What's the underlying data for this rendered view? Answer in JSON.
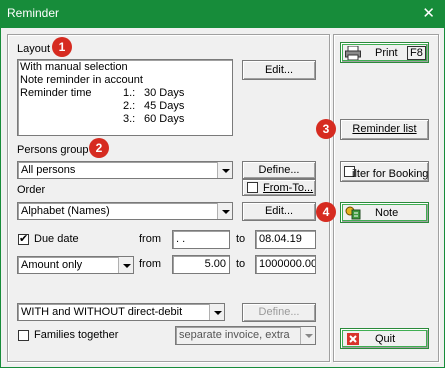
{
  "window": {
    "title": "Reminder",
    "close_symbol": "✕"
  },
  "layout": {
    "label": "Layout",
    "lines": [
      "With manual selection",
      "Note reminder in account"
    ],
    "reminder_time_label": "Reminder time",
    "levels": [
      {
        "n": "1.:",
        "days": "30 Days"
      },
      {
        "n": "2.:",
        "days": "45 Days"
      },
      {
        "n": "3.:",
        "days": "60 Days"
      }
    ],
    "edit_label": "Edit..."
  },
  "persons_group": {
    "label": "Persons group",
    "value": "All persons",
    "define_label": "Define...",
    "from_to_label": "From-To..."
  },
  "order": {
    "label": "Order",
    "value": "Alphabet (Names)",
    "edit_label": "Edit..."
  },
  "due_date": {
    "label": "Due date",
    "checked": true,
    "from_label": "from",
    "from_value": " .  .",
    "to_label": "to",
    "to_value": "08.04.19"
  },
  "amount": {
    "mode_value": "Amount only",
    "from_label": "from",
    "from_value": "5.00",
    "to_label": "to",
    "to_value": "1000000.00"
  },
  "direct_debit": {
    "value": "WITH and WITHOUT direct-debit",
    "define_label": "Define..."
  },
  "families": {
    "label": "Families together",
    "checked": false,
    "invoice_value": "separate invoice, extra"
  },
  "side": {
    "print_label": "Print",
    "print_key": "F8",
    "reminder_list_label": "Reminder list",
    "filter_label": "ilter for Booking",
    "note_label": "Note",
    "quit_label": "Quit"
  },
  "markers": [
    "1",
    "2",
    "3",
    "4"
  ],
  "colors": {
    "titlebar": "#178c3a",
    "marker": "#d62b20",
    "client": "#f0f0f0"
  },
  "icons": {
    "print": "printer-icon",
    "note": "note-icon",
    "quit": "quit-icon"
  }
}
